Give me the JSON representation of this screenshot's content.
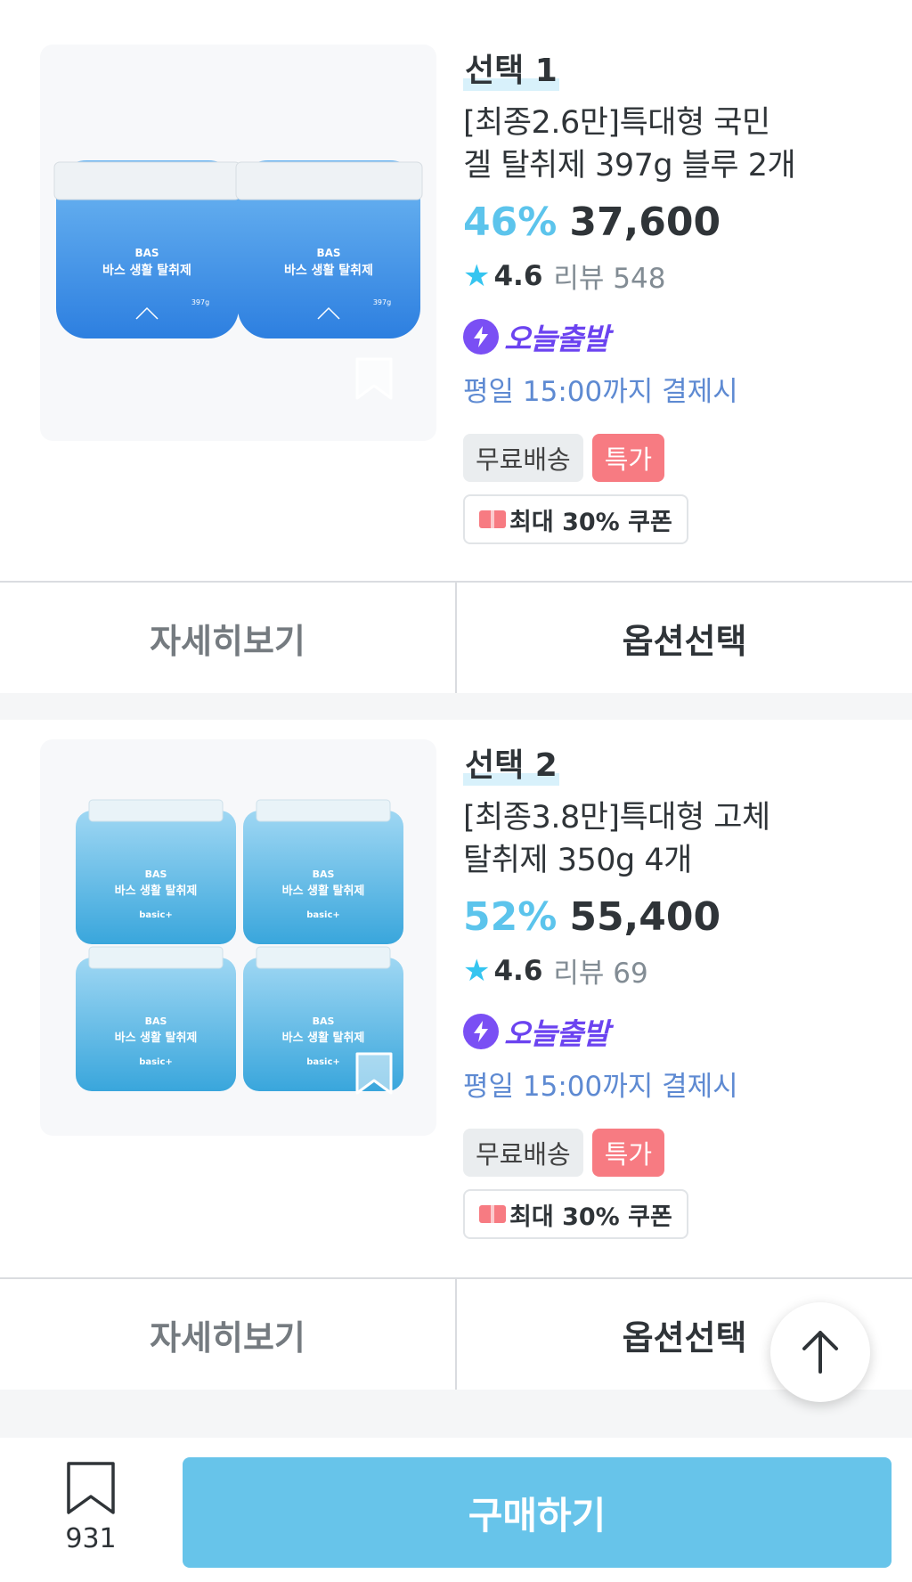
{
  "products": [
    {
      "select_label": "선택 1",
      "title_line1": "[최종2.6만]특대형 국민",
      "title_line2": "겔 탈취제 397g 블루 2개",
      "discount": "46%",
      "price": "37,600",
      "rating": "4.6",
      "reviews": "리뷰 548",
      "delivery": "오늘출발",
      "delivery_sub": "평일 15:00까지 결제시",
      "badge_free": "무료배송",
      "badge_special": "특가",
      "coupon": "최대 30% 쿠폰",
      "image_brand": "BAS",
      "image_text": "바스 생활 탈취제",
      "image_weight": "397g",
      "detail_label": "자세히보기",
      "option_label": "옵션선택"
    },
    {
      "select_label": "선택 2",
      "title_line1": "[최종3.8만]특대형 고체",
      "title_line2": "탈취제 350g 4개",
      "discount": "52%",
      "price": "55,400",
      "rating": "4.6",
      "reviews": "리뷰 69",
      "delivery": "오늘출발",
      "delivery_sub": "평일 15:00까지 결제시",
      "badge_free": "무료배송",
      "badge_special": "특가",
      "coupon": "최대 30% 쿠폰",
      "image_brand": "BAS",
      "image_text": "바스 생활 탈취제",
      "image_sub": "basic+",
      "detail_label": "자세히보기",
      "option_label": "옵션선택"
    }
  ],
  "bottom": {
    "scrap_count": "931",
    "buy_label": "구매하기"
  },
  "colors": {
    "discount": "#5cc4ec",
    "buy": "#67c4ea",
    "delivery": "#6b43f0",
    "special": "#f77b82"
  },
  "icons": [
    "star-icon",
    "bolt-icon",
    "bookmark-icon",
    "arrow-up-icon",
    "coupon-icon"
  ]
}
